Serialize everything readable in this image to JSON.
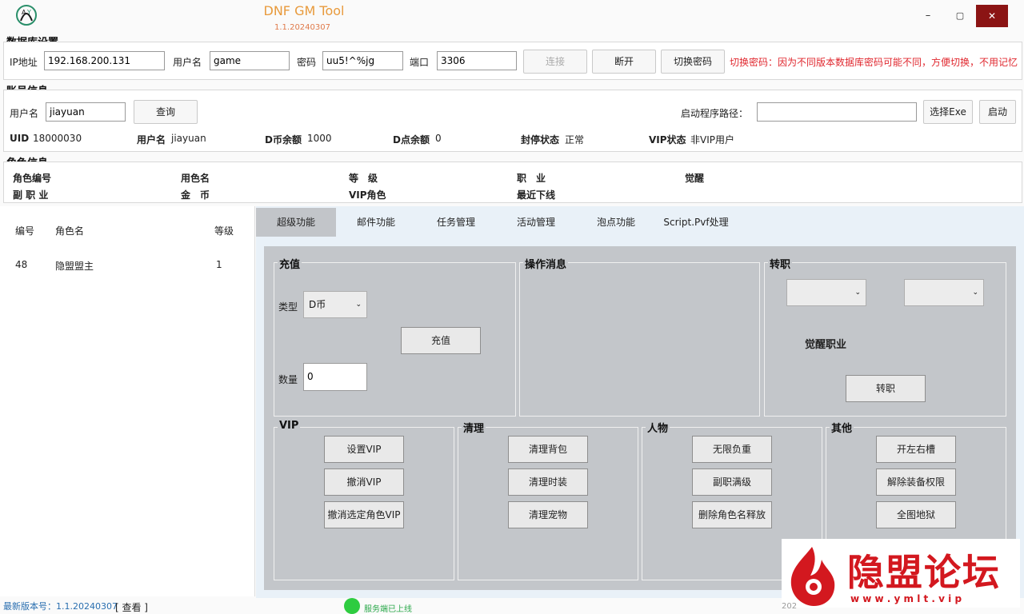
{
  "window": {
    "title": "DNF GM Tool",
    "version": "1.1.20240307",
    "minimize": "–",
    "maximize": "▢",
    "close": "✕"
  },
  "db": {
    "title": "数据库设置",
    "ip_label": "IP地址",
    "ip_value": "192.168.200.131",
    "user_label": "用户名",
    "user_value": "game",
    "pwd_label": "密码",
    "pwd_value": "uu5!^%jg",
    "port_label": "端口",
    "port_value": "3306",
    "connect": "连接",
    "disconnect": "断开",
    "switch_pwd": "切换密码",
    "hint": "切换密码：因为不同版本数据库密码可能不同，方便切换，不用记忆"
  },
  "account": {
    "title": "账号信息",
    "user_label": "用户名",
    "user_value": "jiayuan",
    "query": "查询",
    "launch_path_label": "启动程序路径：",
    "launch_path_value": "",
    "choose_exe": "选择Exe",
    "launch": "启动",
    "uid_label": "UID",
    "uid_value": "18000030",
    "name_label": "用户名",
    "name_value": "jiayuan",
    "dcoin_label": "D币余额",
    "dcoin_value": "1000",
    "dpoint_label": "D点余额",
    "dpoint_value": "0",
    "ban_label": "封停状态",
    "ban_value": "正常",
    "vip_label": "VIP状态",
    "vip_value": "非VIP用户"
  },
  "role": {
    "title": "角色信息",
    "id_label": "角色编号",
    "name_label": "用色名",
    "level_label": "等　级",
    "job_label": "职　业",
    "awake_label": "觉醒",
    "subjob_label": "副 职 业",
    "gold_label": "金　币",
    "vip_label": "VIP角色",
    "lastoff_label": "最近下线"
  },
  "list": {
    "headers": [
      "编号",
      "角色名",
      "等级"
    ],
    "rows": [
      {
        "id": "48",
        "name": "隐盟盟主",
        "level": "1"
      }
    ]
  },
  "tabs": [
    "超级功能",
    "邮件功能",
    "任务管理",
    "活动管理",
    "泡点功能",
    "Script.Pvf处理"
  ],
  "recharge": {
    "title": "充值",
    "type_label": "类型",
    "type_value": "D币",
    "button": "充值",
    "amount_label": "数量",
    "amount_value": "0"
  },
  "oplog": {
    "title": "操作消息"
  },
  "transfer": {
    "title": "转职",
    "combo1": "",
    "combo2": "",
    "awake_label": "觉醒职业",
    "button": "转职"
  },
  "vip": {
    "title": "VIP",
    "buttons": [
      "设置VIP",
      "撤消VIP",
      "撤消选定角色VIP"
    ]
  },
  "clean": {
    "title": "清理",
    "buttons": [
      "清理背包",
      "清理时装",
      "清理宠物"
    ]
  },
  "char": {
    "title": "人物",
    "buttons": [
      "无限负重",
      "副职满级",
      "删除角色名释放"
    ]
  },
  "other": {
    "title": "其他",
    "buttons": [
      "开左右槽",
      "解除装备权限",
      "全图地狱"
    ]
  },
  "status": {
    "latest": "最新版本号：1.1.20240307",
    "view": "[ 查看 ]",
    "server": "服务端已上线",
    "time": "202"
  },
  "watermark": {
    "text": "隐盟论坛",
    "url": "w w w . y m l t . v i p"
  },
  "colors": {
    "accent": "#e89a3c",
    "close": "#8b1414",
    "hint": "#e0282f",
    "online": "#2ecc40",
    "panel": "#c3c6ca"
  }
}
